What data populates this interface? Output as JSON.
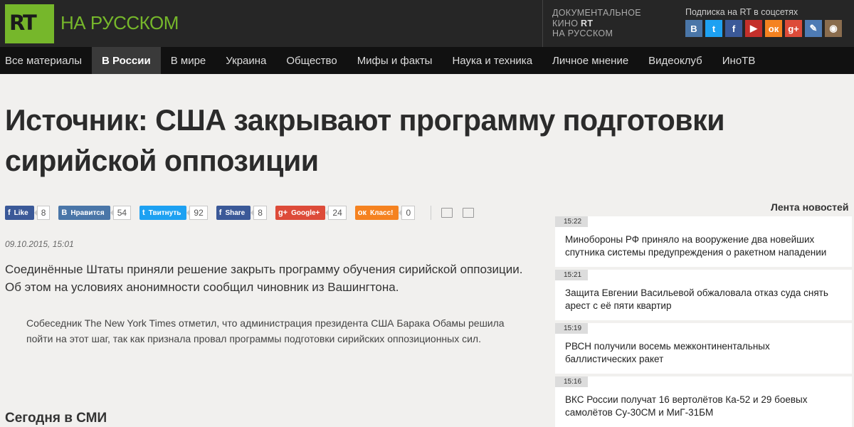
{
  "header": {
    "logo": "RT",
    "logo_text": "НА РУССКОМ",
    "doc_line1": "ДОКУМЕНТАЛЬНОЕ",
    "doc_line2_prefix": "КИНО",
    "doc_line2_rt": "RT",
    "doc_line3": "НА РУССКОМ",
    "social_title": "Подписка на RT в соцсетях",
    "social_icons": [
      {
        "name": "vk-icon",
        "glyph": "B",
        "color": "#4a76a8"
      },
      {
        "name": "twitter-icon",
        "glyph": "t",
        "color": "#1da1f2"
      },
      {
        "name": "facebook-icon",
        "glyph": "f",
        "color": "#3b5998"
      },
      {
        "name": "youtube-icon",
        "glyph": "▶",
        "color": "#c4302b"
      },
      {
        "name": "odnoklassniki-icon",
        "glyph": "ок",
        "color": "#f58220"
      },
      {
        "name": "googleplus-icon",
        "glyph": "g+",
        "color": "#dd4b39"
      },
      {
        "name": "livejournal-icon",
        "glyph": "✎",
        "color": "#4e7bb4"
      },
      {
        "name": "instagram-icon",
        "glyph": "◉",
        "color": "#8a6d4e"
      }
    ]
  },
  "nav": {
    "items": [
      "Все материалы",
      "В России",
      "В мире",
      "Украина",
      "Общество",
      "Мифы и факты",
      "Наука и техника",
      "Личное мнение",
      "Видеоклуб",
      "ИноТВ"
    ],
    "active": "В России"
  },
  "article": {
    "title": "Источник: США закрывают программу подготовки сирийской оппозиции",
    "date": "09.10.2015, 15:01",
    "lead": "Соединённые Штаты приняли решение закрыть программу обучения сирийской оппозиции. Об этом на условиях анонимности сообщил чиновник из Вашингтона.",
    "quote": "Собеседник The New York Times отметил, что администрация президента США Барака Обамы решила пойти на этот шаг, так как признала провал программы подготовки сирийских оппозиционных сил.",
    "today_title": "Сегодня в СМИ"
  },
  "share": [
    {
      "label": "Like",
      "icon": "f",
      "count": "8",
      "color": "#3b5998",
      "name": "facebook-like"
    },
    {
      "label": "Нравится",
      "icon": "B",
      "count": "54",
      "color": "#4a76a8",
      "name": "vk-like"
    },
    {
      "label": "Твитнуть",
      "icon": "t",
      "count": "92",
      "color": "#1da1f2",
      "name": "tweet"
    },
    {
      "label": "Share",
      "icon": "f",
      "count": "8",
      "color": "#3b5998",
      "name": "facebook-share"
    },
    {
      "label": "Google+",
      "icon": "g+",
      "count": "24",
      "color": "#dd4b39",
      "name": "googleplus"
    },
    {
      "label": "Класс!",
      "icon": "ок",
      "count": "0",
      "color": "#f58220",
      "name": "ok-class"
    }
  ],
  "sidebar": {
    "title": "Лента новостей",
    "news": [
      {
        "time": "15:22",
        "text": "Минобороны РФ приняло на вооружение два новейших спутника системы предупреждения о ракетном нападении"
      },
      {
        "time": "15:21",
        "text": "Защита Евгении Васильевой обжаловала отказ суда снять арест с её пяти квартир"
      },
      {
        "time": "15:19",
        "text": "РВСН получили восемь межконтинентальных баллистических ракет"
      },
      {
        "time": "15:16",
        "text": "ВКС России получат 16 вертолётов Ка-52 и 29 боевых самолётов Су-30СМ и МиГ-31БМ"
      }
    ]
  }
}
